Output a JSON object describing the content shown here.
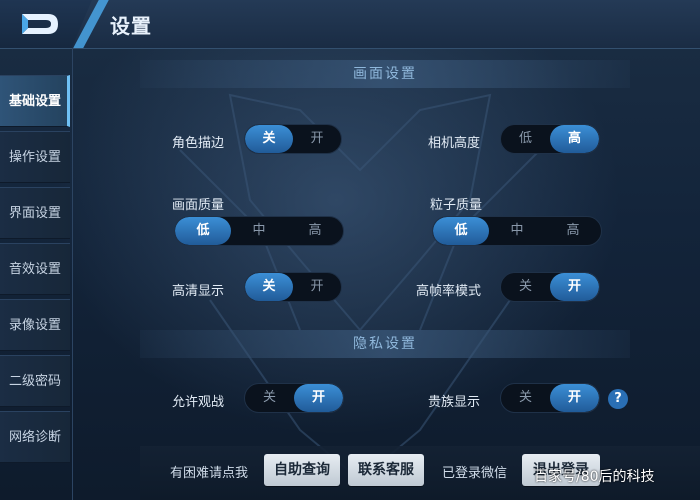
{
  "header": {
    "title": "设置"
  },
  "sidebar": {
    "items": [
      {
        "label": "基础设置",
        "active": true
      },
      {
        "label": "操作设置",
        "active": false
      },
      {
        "label": "界面设置",
        "active": false
      },
      {
        "label": "音效设置",
        "active": false
      },
      {
        "label": "录像设置",
        "active": false
      },
      {
        "label": "二级密码",
        "active": false
      },
      {
        "label": "网络诊断",
        "active": false
      }
    ]
  },
  "sections": {
    "display": {
      "title": "画面设置"
    },
    "privacy": {
      "title": "隐私设置"
    }
  },
  "settings": {
    "outline": {
      "label": "角色描边",
      "options": [
        "关",
        "开"
      ],
      "selected": "关"
    },
    "camera_height": {
      "label": "相机高度",
      "options": [
        "低",
        "高"
      ],
      "selected": "高"
    },
    "quality": {
      "label": "画面质量",
      "options": [
        "低",
        "中",
        "高"
      ],
      "selected": "低"
    },
    "particles": {
      "label": "粒子质量",
      "options": [
        "低",
        "中",
        "高"
      ],
      "selected": "低"
    },
    "hd_display": {
      "label": "高清显示",
      "options": [
        "关",
        "开"
      ],
      "selected": "关"
    },
    "high_fps": {
      "label": "高帧率模式",
      "options": [
        "关",
        "开"
      ],
      "selected": "开"
    },
    "allow_spectate": {
      "label": "允许观战",
      "options": [
        "关",
        "开"
      ],
      "selected": "开"
    },
    "noble_display": {
      "label": "贵族显示",
      "options": [
        "关",
        "开"
      ],
      "selected": "开"
    }
  },
  "help_icon": "?",
  "footer": {
    "help_text": "有困难请点我",
    "self_service": "自助查询",
    "contact_support": "联系客服",
    "login_status": "已登录微信",
    "logout": "退出登录",
    "watermark": "百家号/80后的科技"
  },
  "colors": {
    "accent": "#3b8fd6",
    "background": "#13243a"
  }
}
